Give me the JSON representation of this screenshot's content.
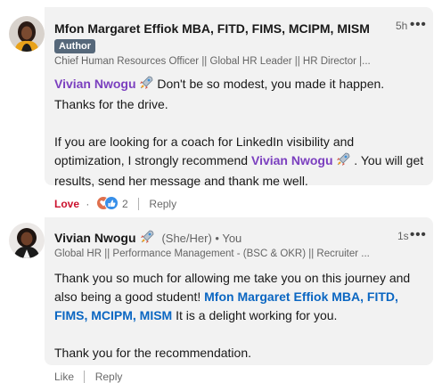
{
  "comment1": {
    "author_name": "Mfon Margaret Effiok MBA, FITD, FIMS, MCIPM, MISM",
    "badge": "Author",
    "headline": "Chief Human Resources Officer || Global HR Leader || HR Director |...",
    "time": "5h",
    "mention1": "Vivian Nwogu",
    "text1": " Don't be so modest, you made it happen. Thanks for the drive.",
    "text2": "If you are looking for a coach for LinkedIn visibility and optimization, I strongly recommend ",
    "mention2": "Vivian Nwogu",
    "text3": " . You will get results, send her message and thank me well.",
    "actions": {
      "like_label": "Love",
      "dot": "·",
      "reaction_count": "2",
      "reply_label": "Reply"
    }
  },
  "comment2": {
    "author_name": "Vivian Nwogu",
    "pronouns": "(She/Her) • You",
    "headline": "Global HR || Performance Management - (BSC & OKR) || Recruiter ...",
    "time": "1s",
    "text1": "Thank you so much for allowing me take you on this journey and also being a good student! ",
    "mention": "Mfon Margaret Effiok MBA, FITD, FIMS, MCIPM, MISM",
    "text2": " It is a delight working for you.",
    "text3": "Thank you for the recommendation.",
    "actions": {
      "like_label": "Like",
      "reply_label": "Reply"
    }
  },
  "icons": {
    "rocket": "rocket-emoji-icon",
    "more": "more-options-icon",
    "reactions": [
      "heart-reaction-icon",
      "like-reaction-icon"
    ]
  },
  "colors": {
    "mention": "#0a66c2",
    "love": "#cb112d",
    "badge": "#56687a",
    "bubble": "#f2f2f2"
  }
}
